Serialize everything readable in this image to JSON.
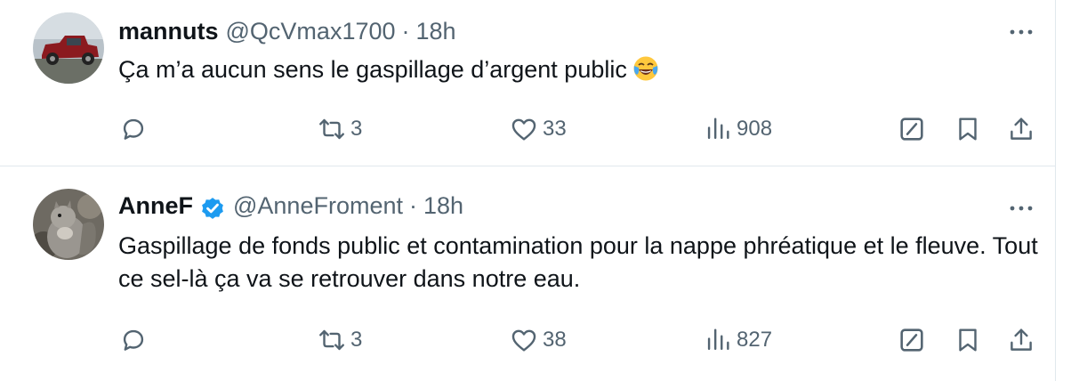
{
  "colors": {
    "text": "#0f1419",
    "muted": "#536471",
    "verified": "#1d9bf0",
    "divider": "#e1e8ed"
  },
  "tweets": [
    {
      "name": "mannuts",
      "handle": "@QcVmax1700",
      "separator": "·",
      "time": "18h",
      "verified": false,
      "text": "Ça m’a aucun sens le gaspillage d’argent public",
      "emoji": "face-with-tears-of-joy",
      "reposts": "3",
      "likes": "33",
      "views": "908"
    },
    {
      "name": "AnneF",
      "handle": "@AnneFroment",
      "separator": "·",
      "time": "18h",
      "verified": true,
      "text": "Gaspillage de fonds public et contamination pour la nappe phréatique et le fleuve. Tout ce sel-là ça va se retrouver dans notre eau.",
      "reposts": "3",
      "likes": "38",
      "views": "827"
    }
  ]
}
